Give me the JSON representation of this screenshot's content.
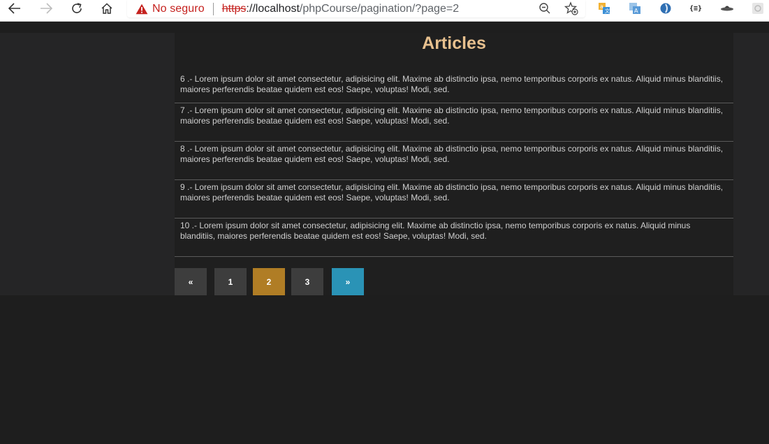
{
  "browser": {
    "not_secure_label": "No seguro",
    "url_scheme": "https",
    "url_host": "://localhost",
    "url_path": "/phpCourse/pagination/?page=2",
    "nav_icons": [
      "back-icon",
      "forward-icon",
      "reload-icon",
      "home-icon"
    ],
    "extension_icons": [
      "translate-extension-icon",
      "translate-alt-extension-icon",
      "circle-extension-icon",
      "json-extension-icon",
      "ufo-extension-icon",
      "settings-extension-icon"
    ],
    "json_ext_label": "{≡}"
  },
  "page": {
    "title": "Articles",
    "articles": [
      {
        "text": "6 .- Lorem ipsum dolor sit amet consectetur, adipisicing elit. Maxime ab distinctio ipsa, nemo temporibus corporis ex natus. Aliquid minus blanditiis, maiores perferendis beatae quidem est eos! Saepe, voluptas! Modi, sed."
      },
      {
        "text": "7 .- Lorem ipsum dolor sit amet consectetur, adipisicing elit. Maxime ab distinctio ipsa, nemo temporibus corporis ex natus. Aliquid minus blanditiis, maiores perferendis beatae quidem est eos! Saepe, voluptas! Modi, sed."
      },
      {
        "text": "8 .- Lorem ipsum dolor sit amet consectetur, adipisicing elit. Maxime ab distinctio ipsa, nemo temporibus corporis ex natus. Aliquid minus blanditiis, maiores perferendis beatae quidem est eos! Saepe, voluptas! Modi, sed."
      },
      {
        "text": "9 .- Lorem ipsum dolor sit amet consectetur, adipisicing elit. Maxime ab distinctio ipsa, nemo temporibus corporis ex natus. Aliquid minus blanditiis, maiores perferendis beatae quidem est eos! Saepe, voluptas! Modi, sed."
      },
      {
        "text": "10 .- Lorem ipsum dolor sit amet consectetur, adipisicing elit. Maxime ab distinctio ipsa, nemo temporibus corporis ex natus. Aliquid minus blanditiis, maiores perferendis beatae quidem est eos! Saepe, voluptas! Modi, sed."
      }
    ],
    "pagination": {
      "prev_label": "«",
      "pages": [
        "1",
        "2",
        "3"
      ],
      "current_page": "2",
      "next_label": "»"
    }
  },
  "colors": {
    "title": "#e7c08e",
    "active_page": "#b07d25",
    "next_button": "#2a93b6",
    "page_button": "#3d3d3d",
    "not_secure": "#c5221f"
  }
}
